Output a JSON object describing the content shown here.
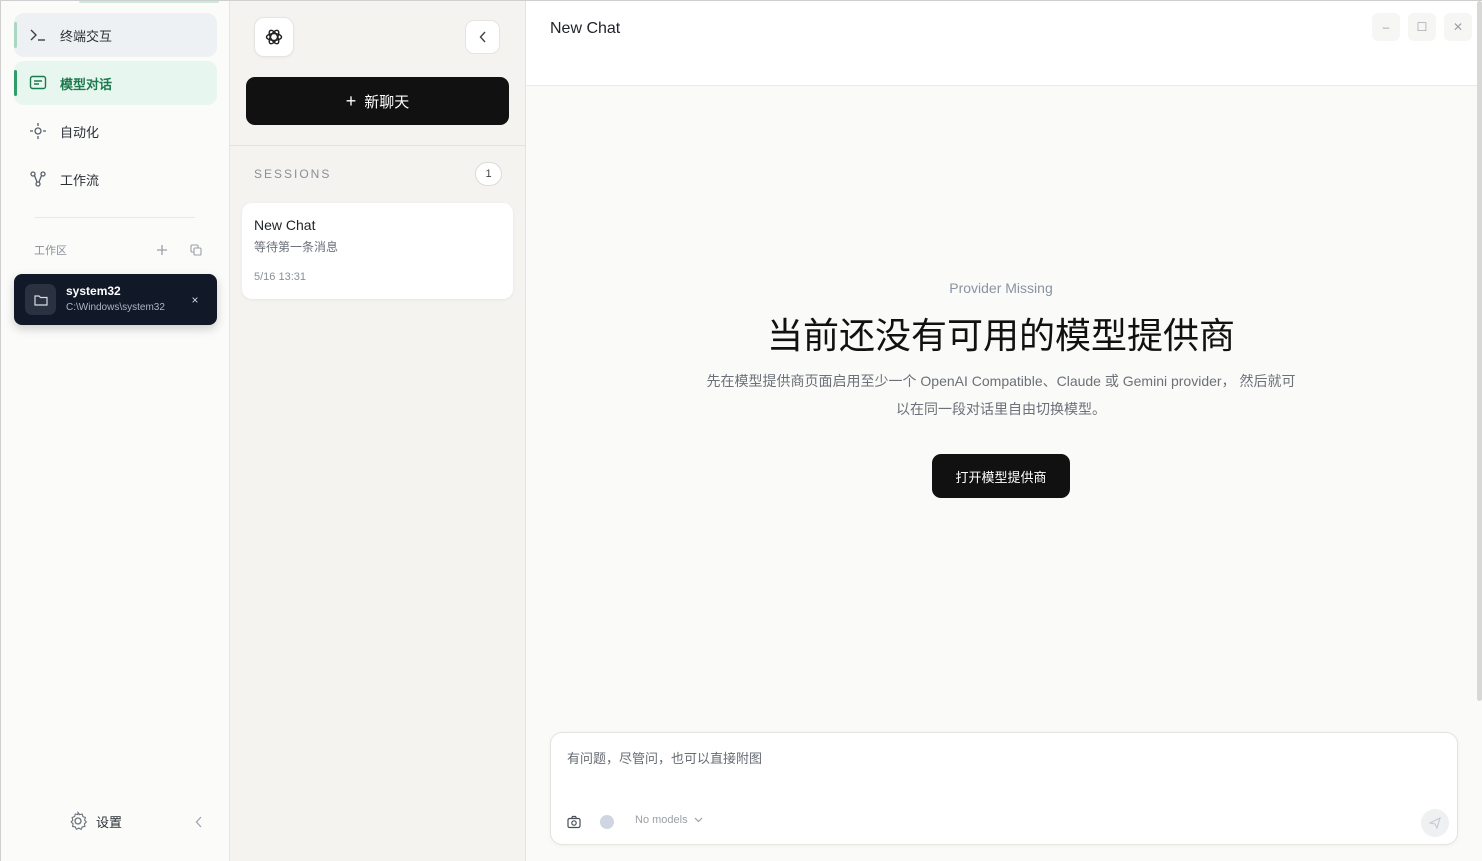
{
  "nav": {
    "items": [
      {
        "label": "终端交互",
        "icon": "terminal-icon"
      },
      {
        "label": "模型对话",
        "icon": "chat-icon"
      },
      {
        "label": "自动化",
        "icon": "automation-icon"
      },
      {
        "label": "工作流",
        "icon": "workflow-icon"
      }
    ],
    "workspace_label": "工作区",
    "workspace": {
      "name": "system32",
      "path": "C:\\Windows\\system32",
      "close": "×"
    },
    "settings_label": "设置"
  },
  "sessions": {
    "new_chat_label": "新聊天",
    "new_chat_plus": "+",
    "header": "SESSIONS",
    "count": "1",
    "list": [
      {
        "title": "New Chat",
        "preview": "等待第一条消息",
        "time": "5/16 13:31"
      }
    ]
  },
  "main": {
    "title": "New Chat",
    "window_controls": {
      "min": "–",
      "max": "☐",
      "close": "✕"
    },
    "empty": {
      "eyebrow": "Provider Missing",
      "headline": "当前还没有可用的模型提供商",
      "description": "先在模型提供商页面启用至少一个 OpenAI Compatible、Claude 或 Gemini provider， 然后就可以在同一段对话里自由切换模型。",
      "button": "打开模型提供商"
    },
    "composer": {
      "placeholder": "有问题，尽管问，也可以直接附图",
      "model_select": "No models"
    }
  },
  "colors": {
    "accent_green": "#2f9e6b",
    "active_bg": "#e7f6ee",
    "dark_button": "#111111",
    "workspace_card": "#111827"
  }
}
